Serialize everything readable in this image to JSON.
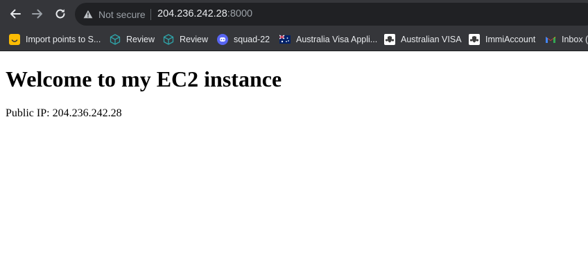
{
  "browser": {
    "security_label": "Not secure",
    "url_host": "204.236.242.28",
    "url_port": ":8000",
    "icons": {
      "back": "arrow-left-icon",
      "forward": "arrow-right-icon",
      "reload": "reload-icon",
      "security": "warning-triangle-icon"
    }
  },
  "bookmarks": [
    {
      "label": "Import points to S...",
      "icon": "yellow-smiley-icon"
    },
    {
      "label": "Review",
      "icon": "teal-cube-icon"
    },
    {
      "label": "Review",
      "icon": "teal-cube-icon"
    },
    {
      "label": "squad-22",
      "icon": "discord-icon"
    },
    {
      "label": "Australia Visa Appli...",
      "icon": "australia-flag-icon"
    },
    {
      "label": "Australian VISA",
      "icon": "crest-icon"
    },
    {
      "label": "ImmiAccount",
      "icon": "crest-icon"
    },
    {
      "label": "Inbox (",
      "icon": "gmail-icon"
    }
  ],
  "page": {
    "title": "Welcome to my EC2 instance",
    "public_ip_text": "Public IP: 204.236.242.28"
  },
  "colors": {
    "chrome_bg": "#35363a",
    "omnibox_bg": "#202124",
    "text_light": "#e8eaed",
    "text_muted": "#9aa0a6"
  }
}
